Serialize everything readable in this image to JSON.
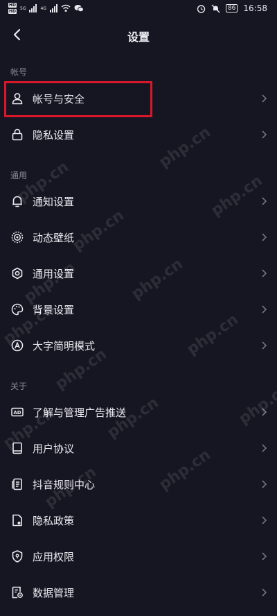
{
  "status_bar": {
    "sim1": "HD",
    "sim2": "HD",
    "net1": "5G",
    "net2": "4G",
    "battery": "86",
    "time": "16:58"
  },
  "header": {
    "title": "设置"
  },
  "sections": [
    {
      "label": "帐号",
      "items": [
        {
          "label": "帐号与安全",
          "icon": "user-icon"
        },
        {
          "label": "隐私设置",
          "icon": "lock-icon"
        }
      ]
    },
    {
      "label": "通用",
      "items": [
        {
          "label": "通知设置",
          "icon": "bell-icon"
        },
        {
          "label": "动态壁纸",
          "icon": "wallpaper-icon"
        },
        {
          "label": "通用设置",
          "icon": "gear-icon"
        },
        {
          "label": "背景设置",
          "icon": "palette-icon"
        },
        {
          "label": "大字简明模式",
          "icon": "font-a-icon"
        }
      ]
    },
    {
      "label": "关于",
      "items": [
        {
          "label": "了解与管理广告推送",
          "icon": "ad-icon"
        },
        {
          "label": "用户协议",
          "icon": "book-icon"
        },
        {
          "label": "抖音规则中心",
          "icon": "rules-doc-icon"
        },
        {
          "label": "隐私政策",
          "icon": "privacy-doc-icon"
        },
        {
          "label": "应用权限",
          "icon": "shield-icon"
        },
        {
          "label": "数据管理",
          "icon": "data-manage-icon"
        }
      ]
    }
  ],
  "watermark_text": "php.cn",
  "colors": {
    "background": "#161622",
    "highlight": "#d8182a",
    "secondary_text": "#8a8894"
  }
}
